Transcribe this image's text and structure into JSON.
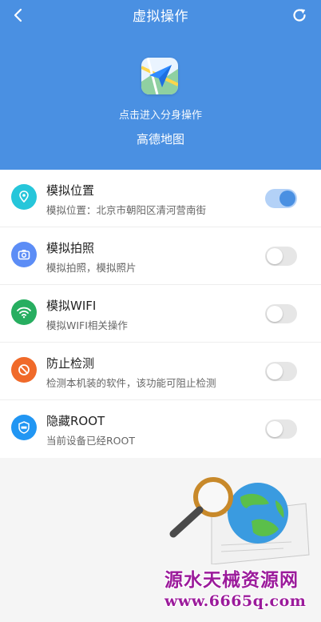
{
  "header": {
    "title": "虚拟操作",
    "back_icon": "chevron-left-icon",
    "refresh_icon": "refresh-icon",
    "bg_color": "#4a90e2",
    "enter_text": "点击进入分身操作",
    "app_name": "高德地图"
  },
  "items": [
    {
      "title": "模拟位置",
      "subtitle": "模拟位置：北京市朝阳区清河营南街",
      "icon": "location-pin-icon",
      "icon_color": "#26c6da",
      "enabled": true
    },
    {
      "title": "模拟拍照",
      "subtitle": "模拟拍照，模拟照片",
      "icon": "camera-icon",
      "icon_color": "#5c8df6",
      "enabled": false
    },
    {
      "title": "模拟WIFI",
      "subtitle": "模拟WIFI相关操作",
      "icon": "wifi-icon",
      "icon_color": "#27ae60",
      "enabled": false
    },
    {
      "title": "防止检测",
      "subtitle": "检测本机装的软件，该功能可阻止检测",
      "icon": "block-icon",
      "icon_color": "#f06a2a",
      "enabled": false
    },
    {
      "title": "隐藏ROOT",
      "subtitle": "当前设备已经ROOT",
      "icon": "shield-root-icon",
      "icon_color": "#2196f3",
      "enabled": false
    }
  ],
  "watermark": {
    "line1": "源水天械资源网",
    "line2": "www.6665q.com"
  }
}
